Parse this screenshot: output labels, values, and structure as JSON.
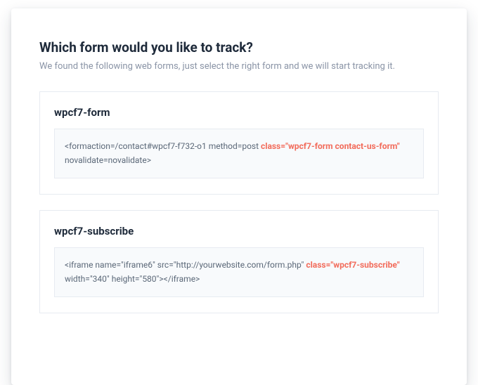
{
  "header": {
    "title": "Which form would you like to track?",
    "subtitle": "We found the following web forms, just select the right form and we will start tracking it."
  },
  "forms": [
    {
      "name": "wpcf7-form",
      "code_before": "<formaction=/contact#wpcf7-f732-o1 method=post ",
      "code_highlight": "class=\"wpcf7-form contact-us-form\"",
      "code_after": " novalidate=novalidate>"
    },
    {
      "name": "wpcf7-subscribe",
      "code_before": "<iframe name=\"iframe6\" src=\"http://yourwebsite.com/form.php\" ",
      "code_highlight": "class=\"wpcf7-subscribe\"",
      "code_after": " width=\"340\" height=\"580\"></iframe>"
    }
  ]
}
